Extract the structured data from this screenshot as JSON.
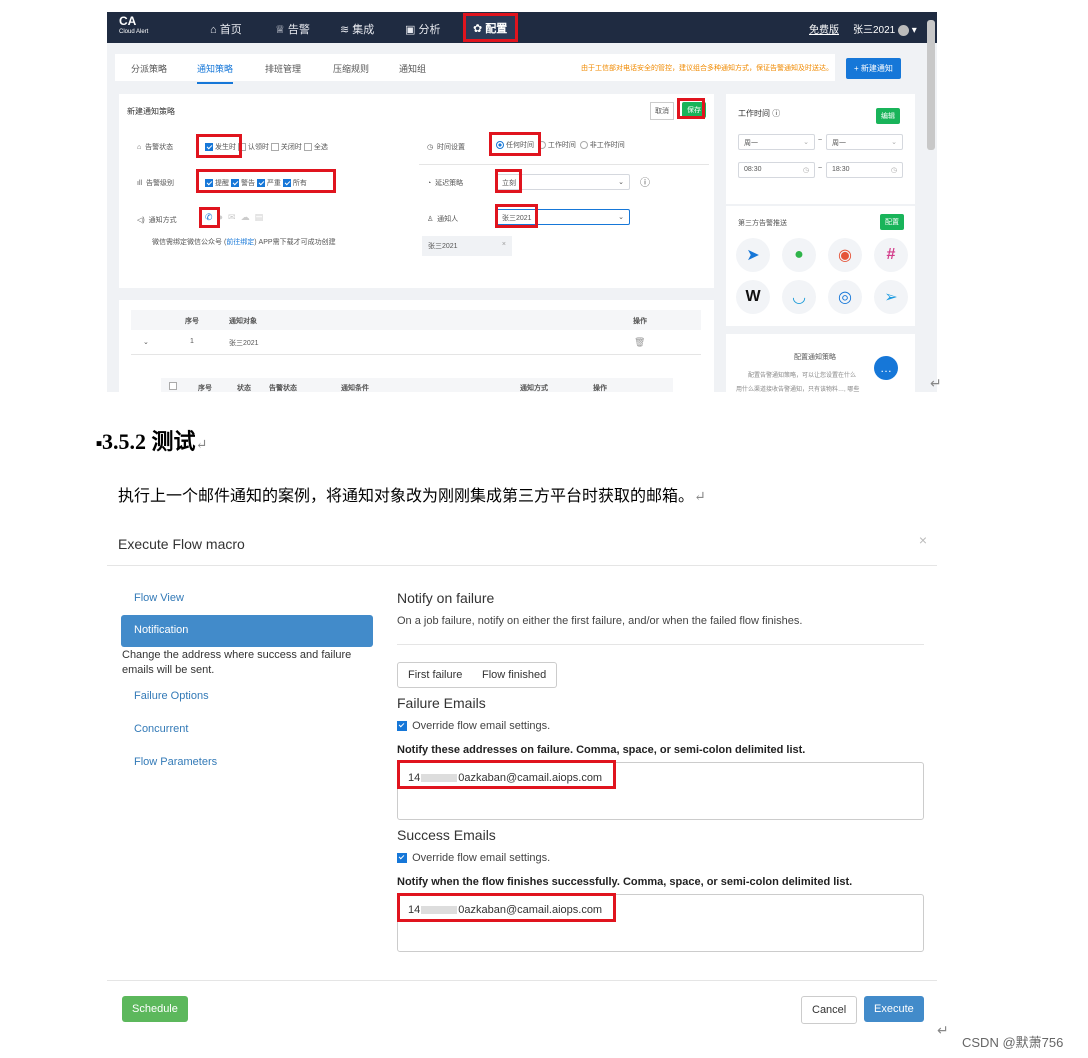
{
  "shot1": {
    "logo": {
      "title": "CA",
      "subtitle": "Cloud Alert"
    },
    "nav": [
      "首页",
      "告警",
      "集成",
      "分析",
      "配置"
    ],
    "user": {
      "edition": "免费版",
      "name": "张三2021"
    },
    "tabs": [
      "分派策略",
      "通知策略",
      "排班管理",
      "压缩规则",
      "通知组"
    ],
    "tip": "由于工信部对电话安全的管控，建议组合多种通知方式，保证告警通知及时送达。",
    "new_button": "+ 新建通知",
    "form": {
      "title": "新建通知策略",
      "cancel": "取消",
      "save": "保存",
      "status_label": "告警状态",
      "status_options": [
        "发生时",
        "认领时",
        "关闭时",
        "全选"
      ],
      "time_label": "时间设置",
      "time_options": [
        "任何时间",
        "工作时间",
        "非工作时间"
      ],
      "level_label": "告警级别",
      "level_options": [
        "提醒",
        "警告",
        "严重",
        "所有"
      ],
      "delay_label": "延迟策略",
      "delay_value": "立刻",
      "method_label": "通知方式",
      "notify_label": "通知人",
      "notify_value": "张三2021",
      "wechat_note_pre": "微信需绑定微信公众号 (",
      "wechat_link": "前往绑定",
      "wechat_note_post": ") APP需下载才可成功创建",
      "tag": "张三2021"
    },
    "table": {
      "headers": [
        "序号",
        "通知对象",
        "操作"
      ],
      "row": {
        "index": "1",
        "target": "张三2021"
      },
      "sub_headers": [
        "序号",
        "状态",
        "告警状态",
        "通知条件",
        "通知方式",
        "操作"
      ]
    },
    "worktime": {
      "title": "工作时间",
      "edit": "编辑",
      "day_from": "周一",
      "day_to": "周一",
      "time_from": "08:30",
      "time_to": "18:30",
      "sep": "~"
    },
    "third": {
      "title": "第三方告警推送",
      "config": "配置"
    },
    "config_panel": {
      "title": "配置通知策略",
      "text1": "配置告警通知策略，可以让您设置在什么",
      "text2": "用什么渠道接收告警通知，只有该物料…, 哪些"
    }
  },
  "heading": "3.5.2  测试",
  "paragraph": "执行上一个邮件通知的案例，将通知对象改为刚刚集成第三方平台时获取的邮箱。",
  "shot2": {
    "title": "Execute Flow macro",
    "close": "×",
    "sidebar": [
      "Flow View",
      "Notification",
      "Failure Options",
      "Concurrent",
      "Flow Parameters"
    ],
    "sidebar_note": "Change the address where success and failure emails will be sent.",
    "section_title": "Notify on failure",
    "section_desc": "On a job failure, notify on either the first failure, and/or when the failed flow finishes.",
    "tabs": [
      "First failure",
      "Flow finished"
    ],
    "failure_title": "Failure Emails",
    "override": "Override flow email settings.",
    "failure_label": "Notify these addresses on failure. Comma, space, or semi-colon delimited list.",
    "email_prefix": "14",
    "email_suffix": "0azkaban@camail.aiops.com",
    "success_title": "Success Emails",
    "success_label": "Notify when the flow finishes successfully. Comma, space, or semi-colon delimited list.",
    "schedule": "Schedule",
    "cancel": "Cancel",
    "execute": "Execute"
  },
  "watermark": "CSDN @默萧756",
  "colors": {
    "primary": "#1677d8",
    "green": "#19b45a",
    "highlight": "#e0141e",
    "dark_nav": "#1f2b41"
  }
}
